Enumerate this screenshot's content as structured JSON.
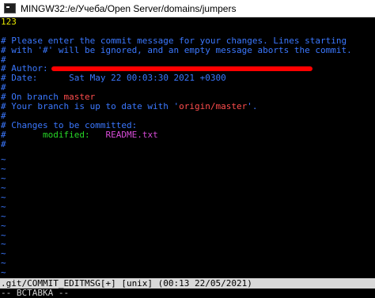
{
  "window": {
    "title": "MINGW32:/e/Учеба/Open Server/domains/jumpers"
  },
  "editor": {
    "first_line": "123",
    "comment_1": "# Please enter the commit message for your changes. Lines starting",
    "comment_2": "# with '#' will be ignored, and an empty message aborts the commit.",
    "comment_3": "#",
    "author_prefix": "# Author:",
    "date_prefix": "# Date:",
    "date_value": "Sat May 22 00:03:30 2021 +0300",
    "comment_4": "#",
    "branch_prefix": "# On branch ",
    "branch_name": "master",
    "uptodate_prefix": "# Your branch is up to date with '",
    "uptodate_remote": "origin/master",
    "uptodate_suffix": "'.",
    "comment_5": "#",
    "changes_prefix": "# ",
    "changes_label": "Changes to be committed:",
    "modified_prefix": "#",
    "modified_label": "modified:",
    "modified_file": "README.txt",
    "comment_6": "#",
    "tilde": "~"
  },
  "statusbar": {
    "text": ".git/COMMIT_EDITMSG[+] [unix] (00:13 22/05/2021)"
  },
  "modeline": {
    "text": "-- ВСТАВКА --"
  }
}
